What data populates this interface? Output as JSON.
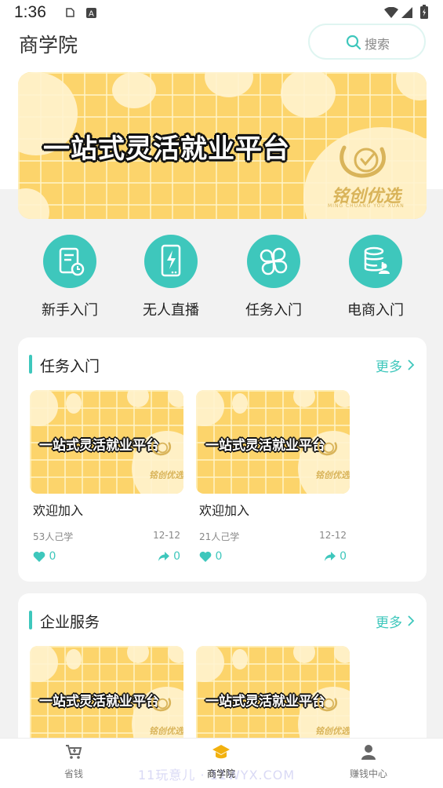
{
  "status_bar": {
    "time": "1:36"
  },
  "header": {
    "title": "商学院",
    "search_placeholder": "搜索"
  },
  "banner": {
    "headline": "一站式灵活就业平台",
    "logo_text": "铭创优选",
    "logo_subtext": "MING CHUANG YOU XUAN"
  },
  "categories": [
    {
      "label": "新手入门",
      "icon": "document-clock-icon"
    },
    {
      "label": "无人直播",
      "icon": "phone-lightning-icon"
    },
    {
      "label": "任务入门",
      "icon": "clover-icon"
    },
    {
      "label": "电商入门",
      "icon": "database-user-icon"
    }
  ],
  "sections": [
    {
      "title": "任务入门",
      "more": "更多",
      "courses": [
        {
          "thumb_text": "一站式灵活就业平台",
          "logo_text": "铭创优选",
          "title": "欢迎加入",
          "learners": "53人己学",
          "date": "12-12",
          "likes": "0",
          "shares": "0"
        },
        {
          "thumb_text": "一站式灵活就业平台",
          "logo_text": "铭创优选",
          "title": "欢迎加入",
          "learners": "21人己学",
          "date": "12-12",
          "likes": "0",
          "shares": "0"
        }
      ]
    },
    {
      "title": "企业服务",
      "more": "更多",
      "courses": [
        {
          "thumb_text": "一站式灵活就业平台",
          "logo_text": "铭创优选"
        },
        {
          "thumb_text": "一站式灵活就业平台",
          "logo_text": "铭创优选"
        }
      ]
    }
  ],
  "bottom_nav": [
    {
      "label": "省钱",
      "icon": "cart-icon",
      "active": false
    },
    {
      "label": "商学院",
      "icon": "graduation-cap-icon",
      "active": true
    },
    {
      "label": "赚钱中心",
      "icon": "user-icon",
      "active": false
    }
  ],
  "watermark": "11玩意儿 · 11WYX.COM",
  "colors": {
    "accent": "#3ec7bc",
    "banner": "#fcd46b",
    "nav_active": "#f2b10f"
  }
}
